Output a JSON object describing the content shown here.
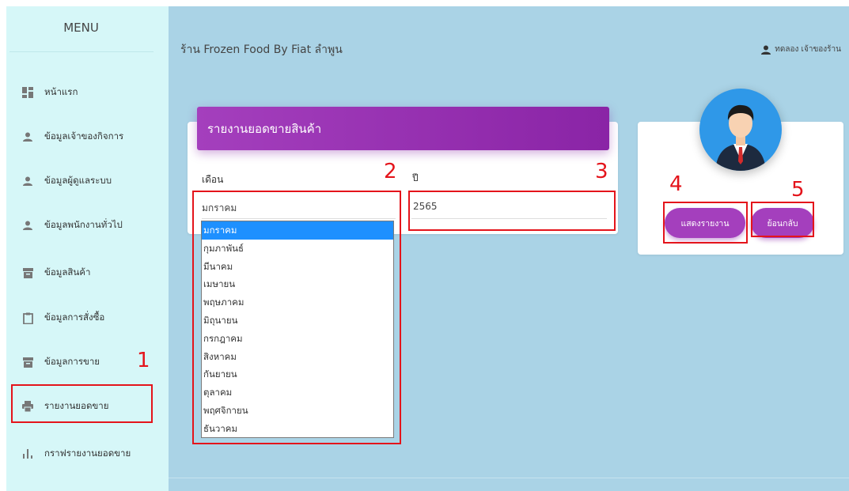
{
  "sidebar": {
    "title": "MENU",
    "items": [
      {
        "label": "หน้าแรก",
        "icon": "dashboard-icon"
      },
      {
        "label": "ข้อมูลเจ้าของกิจการ",
        "icon": "person-icon"
      },
      {
        "label": "ข้อมูลผู้ดูแลระบบ",
        "icon": "person-icon"
      },
      {
        "label": "ข้อมูลพนักงานทั่วไป",
        "icon": "person-icon"
      },
      {
        "label": "ข้อมูลสินค้า",
        "icon": "archive-icon"
      },
      {
        "label": "ข้อมูลการสั่งซื้อ",
        "icon": "clipboard-icon"
      },
      {
        "label": "ข้อมูลการขาย",
        "icon": "archive-icon"
      },
      {
        "label": "รายงานยอดขาย",
        "icon": "printer-icon"
      },
      {
        "label": "กราฟรายงานยอดขาย",
        "icon": "bar-chart-icon"
      }
    ]
  },
  "header": {
    "shop_name": "ร้าน Frozen Food By Fiat ลำพูน",
    "user_label": "ทดลอง เจ้าของร้าน"
  },
  "report": {
    "title": "รายงานยอดขายสินค้า",
    "month_label": "เดือน",
    "year_label": "ปี",
    "month_value": "มกราคม",
    "year_value": "2565",
    "month_options": [
      "มกราคม",
      "กุมภาพันธ์",
      "มีนาคม",
      "เมษายน",
      "พฤษภาคม",
      "มิถุนายน",
      "กรกฎาคม",
      "สิงหาคม",
      "กันยายน",
      "ตุลาคม",
      "พฤศจิกายน",
      "ธันวาคม"
    ]
  },
  "actions": {
    "show_report": "แสดงรายงาน",
    "back": "ย้อนกลับ"
  },
  "annotations": [
    "1",
    "2",
    "3",
    "4",
    "5"
  ],
  "colors": {
    "sidebar_bg": "#d6f7f8",
    "main_bg": "#aad3e6",
    "accent": "#a43fbd",
    "highlight": "#e4141b",
    "selected_option": "#1e90ff"
  }
}
